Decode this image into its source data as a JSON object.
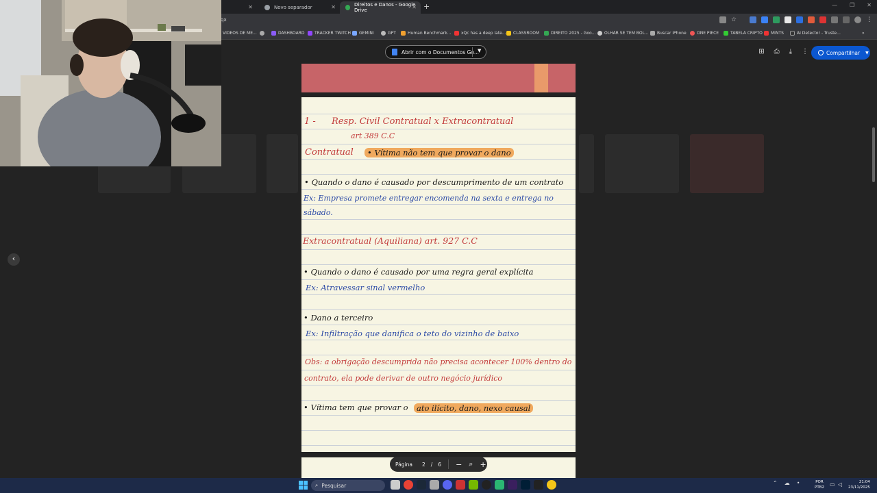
{
  "browser": {
    "tabs": [
      {
        "label": ""
      },
      {
        "label": "Novo separador"
      },
      {
        "label": "Direitos e Danos - Google Drive"
      }
    ],
    "url_fragment": "qx",
    "bookmarks": [
      "VIDEOS DE ME...",
      "DASHBOARD",
      "TRACKER TWITCH",
      "GEMINI",
      "GPT",
      "Human Benchmark...",
      "xQc has a deep late...",
      "CLASSROOM",
      "DIREITO 2025 - Goo...",
      "OLHAR SE TEM BOL...",
      "Buscar iPhone",
      "ONE PIECE",
      "TABELA CRIPTO",
      "MINTS",
      "AI Detector - Truste..."
    ]
  },
  "viewer": {
    "open_with_label": "Abrir com o Documentos Go...",
    "share_label": "Compartilhar",
    "page_nav": {
      "label": "Página",
      "current": "2",
      "separator": "/",
      "total": "6"
    }
  },
  "notes": {
    "heading_num": "1 -",
    "heading": "Resp. Civil Contratual x Extracontratual",
    "heading_art": "art 389 C.C",
    "contratual_label": "Contratual",
    "contratual_note": "• Vítima não tem que provar o dano",
    "contratual_point": "• Quando o dano é causado por descumprimento de um contrato",
    "contratual_ex_1": "Ex: Empresa promete entregar encomenda na sexta e entrega no",
    "contratual_ex_2": "sábado.",
    "extra_label": "Extracontratual (Aquiliana) art. 927 C.C",
    "extra_point": "• Quando o dano é causado por uma regra geral explícita",
    "extra_ex": "Ex: Atravessar sinal vermelho",
    "dano_label": "• Dano a terceiro",
    "dano_ex": "Ex: Infiltração que danifica o teto do vizinho de baixo",
    "obs_1": "Obs: a obrigação descumprida não precisa acontecer 100% dentro do",
    "obs_2": "contrato, ela pode derivar de outro negócio jurídico",
    "victim_prefix": "• Vítima tem que provar o",
    "victim_highlight": "ato ilícito, dano, nexo causal"
  },
  "taskbar": {
    "search_label": "Pesquisar",
    "lang_line1": "POR",
    "lang_line2": "PTB2",
    "time": "21:04",
    "date": "23/11/2025"
  },
  "colors": {
    "red_ink": "#c23a3a",
    "blue_ink": "#2c4aa6",
    "highlight": "#f0a95e",
    "share_blue": "#0b57d0"
  }
}
